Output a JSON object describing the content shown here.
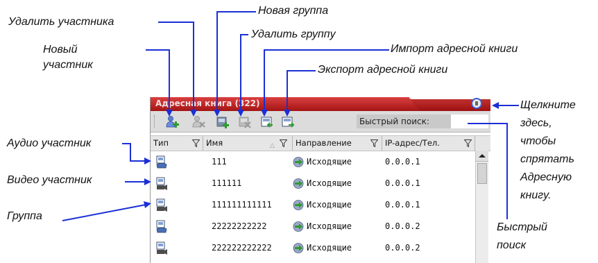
{
  "callouts": {
    "delete_member": "Удалить участника",
    "new_group": "Новая группа",
    "delete_group": "Удалить группу",
    "import_book": "Импорт адресной книги",
    "export_book": "Экспорт адресной книги",
    "new_member_line1": "Новый",
    "new_member_line2": "участник",
    "hide_hint_lines": [
      "Щелкните",
      "здесь,",
      "чтобы",
      "спрятать",
      "Адресную",
      "книгу."
    ],
    "audio_member": "Аудио участник",
    "video_member": "Видео участник",
    "group": "Группа",
    "quick_search_line1": "Быстрый",
    "quick_search_line2": "поиск"
  },
  "window": {
    "title": "Адресная книга (322)",
    "search_label": "Быстрый поиск:",
    "search_value": ""
  },
  "columns": {
    "type": "Тип",
    "name": "Имя",
    "direction": "Направление",
    "ip": "IP-адрес/Тел."
  },
  "rows": [
    {
      "kind": "audio",
      "name": "111",
      "direction": "Исходящие",
      "ip": "0.0.0.1"
    },
    {
      "kind": "video",
      "name": "111111",
      "direction": "Исходящие",
      "ip": "0.0.0.1"
    },
    {
      "kind": "group",
      "name": "111111111111",
      "direction": "Исходящие",
      "ip": "0.0.0.1"
    },
    {
      "kind": "audio",
      "name": "22222222222",
      "direction": "Исходящие",
      "ip": "0.0.0.2"
    },
    {
      "kind": "video",
      "name": "222222222222",
      "direction": "Исходящие",
      "ip": "0.0.0.2"
    }
  ],
  "colors": {
    "title_bar": "#b81c1c",
    "callout_line": "#1a2fd6",
    "hide_button_ring": "#3b5bd1"
  }
}
